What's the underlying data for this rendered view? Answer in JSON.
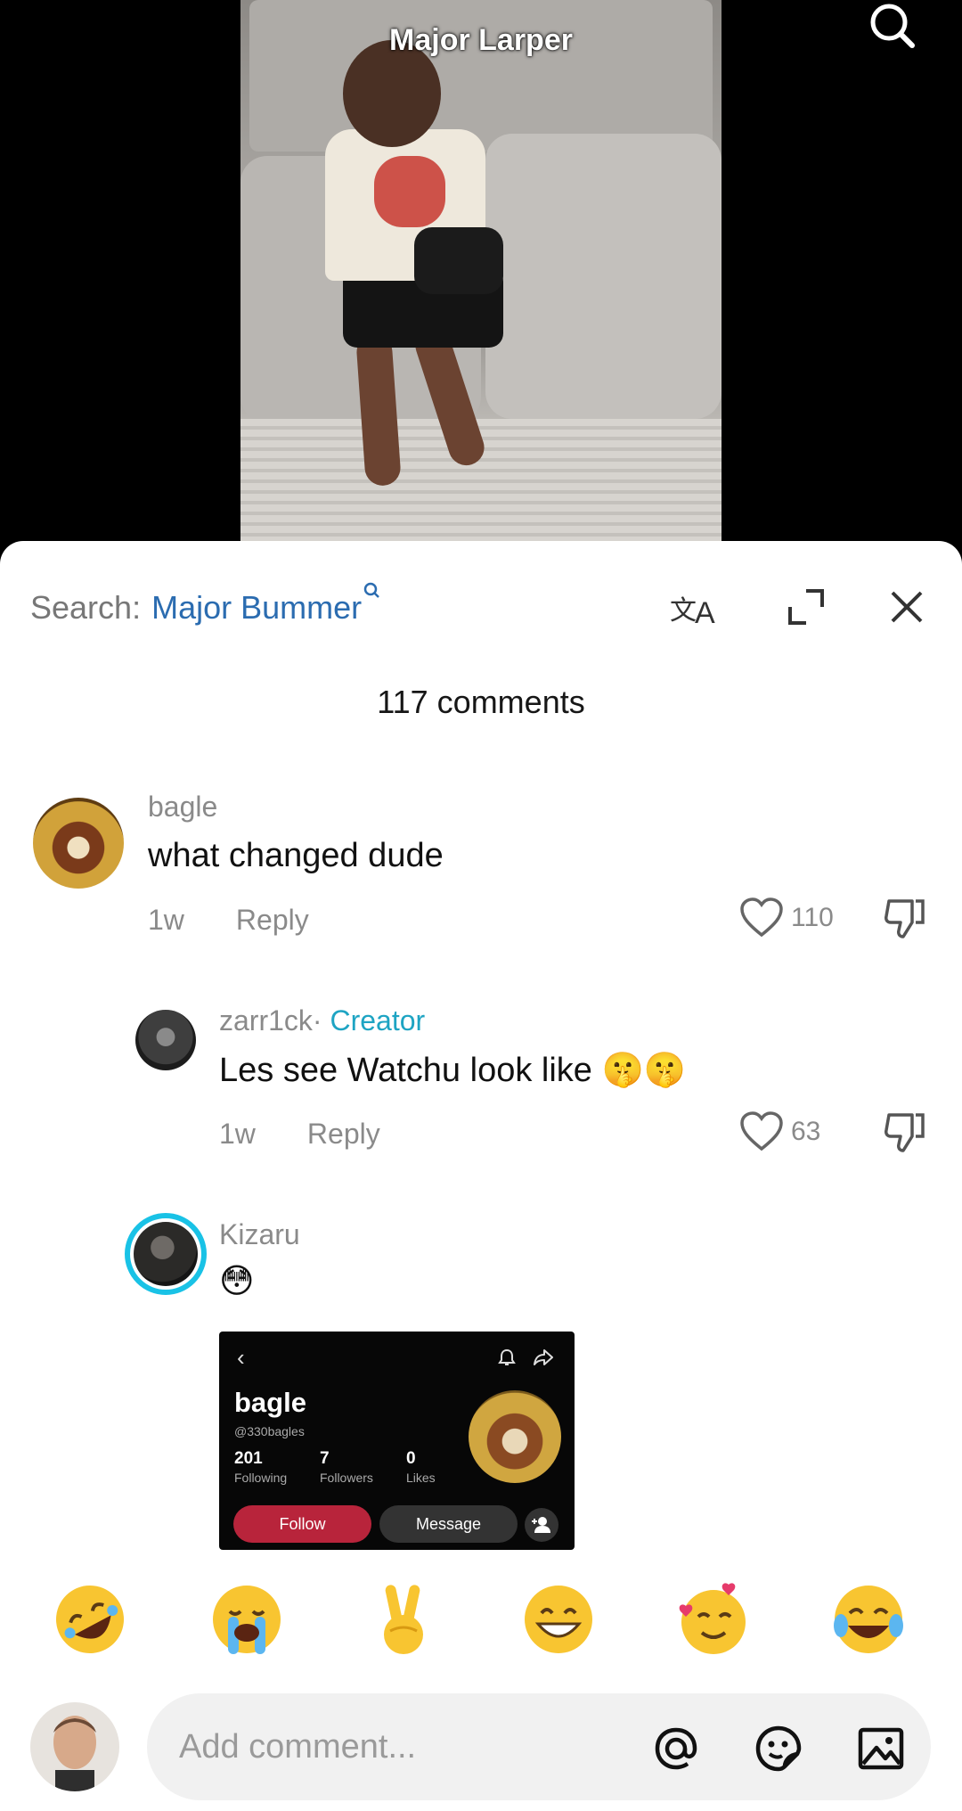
{
  "video": {
    "title": "Major Larper"
  },
  "sheet": {
    "search_prefix": "Search:",
    "search_term": "Major Bummer",
    "comment_count": "117 comments"
  },
  "comments": [
    {
      "username": "bagle",
      "text": "what changed dude",
      "time": "1w",
      "reply_label": "Reply",
      "likes": "110"
    },
    {
      "username": "zarr1ck",
      "separator": "·",
      "badge": "Creator",
      "text": "Les see Watchu look like 🤫🤫",
      "time": "1w",
      "reply_label": "Reply",
      "likes": "63"
    },
    {
      "username": "Kizaru",
      "text": "😳"
    }
  ],
  "attachment": {
    "name": "bagle",
    "handle": "@330bagles",
    "following": "201",
    "following_label": "Following",
    "followers": "7",
    "followers_label": "Followers",
    "likes": "0",
    "likes_label": "Likes",
    "follow_label": "Follow",
    "message_label": "Message"
  },
  "quick_emojis": [
    "🤣",
    "😭",
    "✌️",
    "😁",
    "🥰",
    "😂"
  ],
  "composer": {
    "placeholder": "Add comment..."
  },
  "colors": {
    "link_blue": "#2b6cb0",
    "creator_teal": "#1ea4c3",
    "follow_red": "#b8243b",
    "story_ring": "#19c2e6"
  },
  "icons": [
    "search-icon",
    "translate-icon",
    "expand-icon",
    "close-icon",
    "heart-icon",
    "dislike-icon",
    "mention-icon",
    "sticker-icon",
    "image-icon"
  ]
}
